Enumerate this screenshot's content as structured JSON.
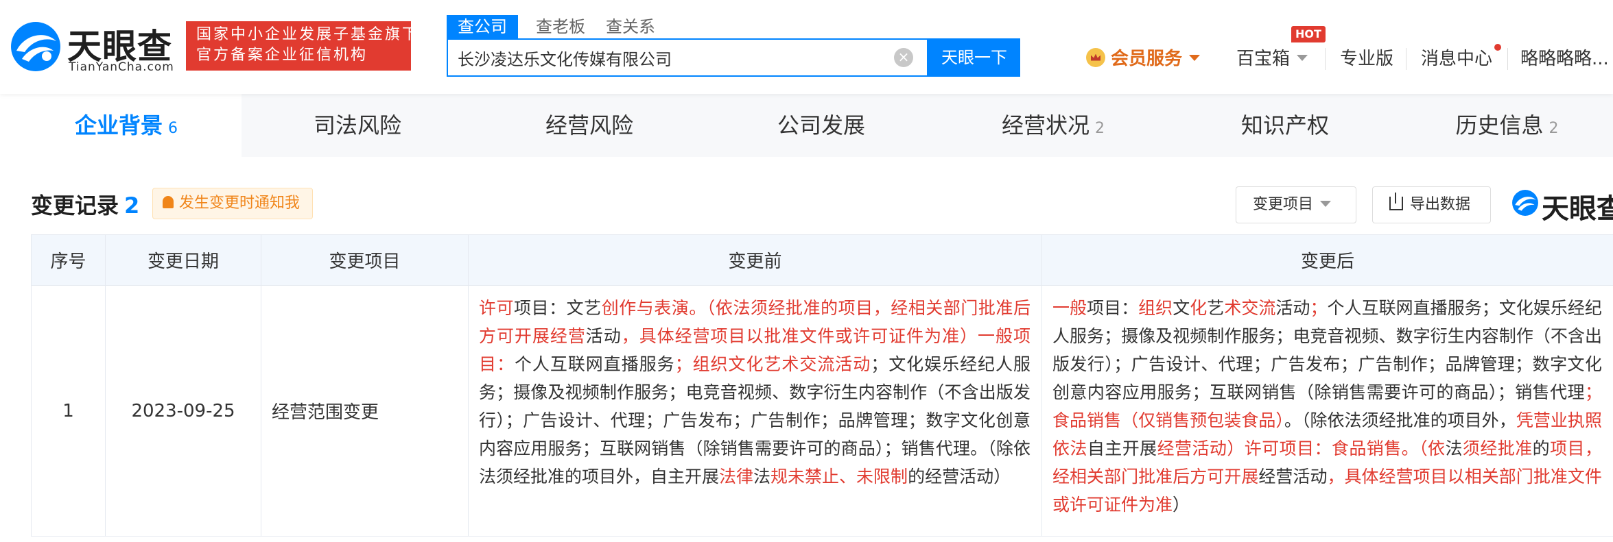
{
  "header": {
    "logo": {
      "name": "天眼查",
      "domain": "TianYanCha.com"
    },
    "tagline": {
      "line1": "国家中小企业发展子基金旗下",
      "line2": "官方备案企业征信机构"
    },
    "search_tabs": [
      "查公司",
      "查老板",
      "查关系"
    ],
    "search": {
      "value": "长沙凌达乐文化传媒有限公司",
      "button": "天眼一下"
    },
    "nav": {
      "vip": "会员服务",
      "baibao": "百宝箱",
      "hot": "HOT",
      "pro": "专业版",
      "messages": "消息中心",
      "user": "略略略略..."
    }
  },
  "category_tabs": [
    {
      "label": "企业背景",
      "count": "6"
    },
    {
      "label": "司法风险",
      "count": ""
    },
    {
      "label": "经营风险",
      "count": ""
    },
    {
      "label": "公司发展",
      "count": ""
    },
    {
      "label": "经营状况",
      "count": "2"
    },
    {
      "label": "知识产权",
      "count": ""
    },
    {
      "label": "历史信息",
      "count": "2"
    }
  ],
  "section": {
    "title": "变更记录",
    "count": "2",
    "notify": "发生变更时通知我",
    "filter": "变更项目",
    "export": "导出数据",
    "watermark": "天眼查"
  },
  "table": {
    "headers": [
      "序号",
      "变更日期",
      "变更项目",
      "变更前",
      "变更后"
    ],
    "rows": [
      {
        "index": "1",
        "date": "2023-09-25",
        "item": "经营范围变更",
        "before": [
          {
            "t": "许可",
            "hl": true
          },
          {
            "t": "项目：文艺",
            "hl": false
          },
          {
            "t": "创作与表演。（依法须经批准的项目，经相关部门批准后方可开展经营",
            "hl": true
          },
          {
            "t": "活动",
            "hl": false
          },
          {
            "t": "，具体经营项目以批准文件或许可证件为准）一般项目：",
            "hl": true
          },
          {
            "t": "个人互联网直播服务",
            "hl": false
          },
          {
            "t": "；组织文化艺术交流活动",
            "hl": true
          },
          {
            "t": "；文化娱乐经纪人服务；摄像及视频制作服务；电竞音视频、数字衍生内容制作（不含出版发行）；广告设计、代理；广告发布；广告制作；品牌管理；数字文化创意内容应用服务；互联网销售（除销售需要许可的商品）；销售代理。（除依法须经批准的项目外，自主开展",
            "hl": false
          },
          {
            "t": "法律",
            "hl": true
          },
          {
            "t": "法",
            "hl": false
          },
          {
            "t": "规未禁止、未限制",
            "hl": true
          },
          {
            "t": "的经营活动）",
            "hl": false
          }
        ],
        "after": [
          {
            "t": "一般",
            "hl": true
          },
          {
            "t": "项目：",
            "hl": false
          },
          {
            "t": "组织",
            "hl": true
          },
          {
            "t": "文",
            "hl": false
          },
          {
            "t": "化",
            "hl": true
          },
          {
            "t": "艺",
            "hl": false
          },
          {
            "t": "术交流",
            "hl": true
          },
          {
            "t": "活动",
            "hl": false
          },
          {
            "t": "；",
            "hl": true
          },
          {
            "t": "个人互联网直播服务；文化娱乐经纪人服务；摄像及视频制作服务；电竞音视频、数字衍生内容制作（不含出版发行）；广告设计、代理；广告发布；广告制作；品牌管理；数字文化创意内容应用服务；互联网销售（除销售需要许可的商品）；销售代理",
            "hl": false
          },
          {
            "t": "；食品销售（仅销售预包装食品）",
            "hl": true
          },
          {
            "t": "。（除依法须经批准的项目外，",
            "hl": false
          },
          {
            "t": "凭营业执照依法",
            "hl": true
          },
          {
            "t": "自主开展",
            "hl": false
          },
          {
            "t": "经营活动）许可项目：食品销售。（依",
            "hl": true
          },
          {
            "t": "法",
            "hl": false
          },
          {
            "t": "须经批准",
            "hl": true
          },
          {
            "t": "的",
            "hl": false
          },
          {
            "t": "项目，经相关部门批准后方可开展",
            "hl": true
          },
          {
            "t": "经营活动",
            "hl": false
          },
          {
            "t": "，具体经营项目以相关部门批准文件或许可证件为准",
            "hl": true
          },
          {
            "t": "）",
            "hl": false
          }
        ]
      }
    ]
  },
  "colors": {
    "brand": "#0084ff",
    "highlight": "#e13b30",
    "tagline_bg": "#e13b30",
    "vip": "#e06a1a"
  },
  "icons": [
    "tianyancha-logo-icon",
    "clear-icon",
    "crown-icon",
    "chevron-down-icon",
    "bell-icon",
    "export-icon"
  ]
}
